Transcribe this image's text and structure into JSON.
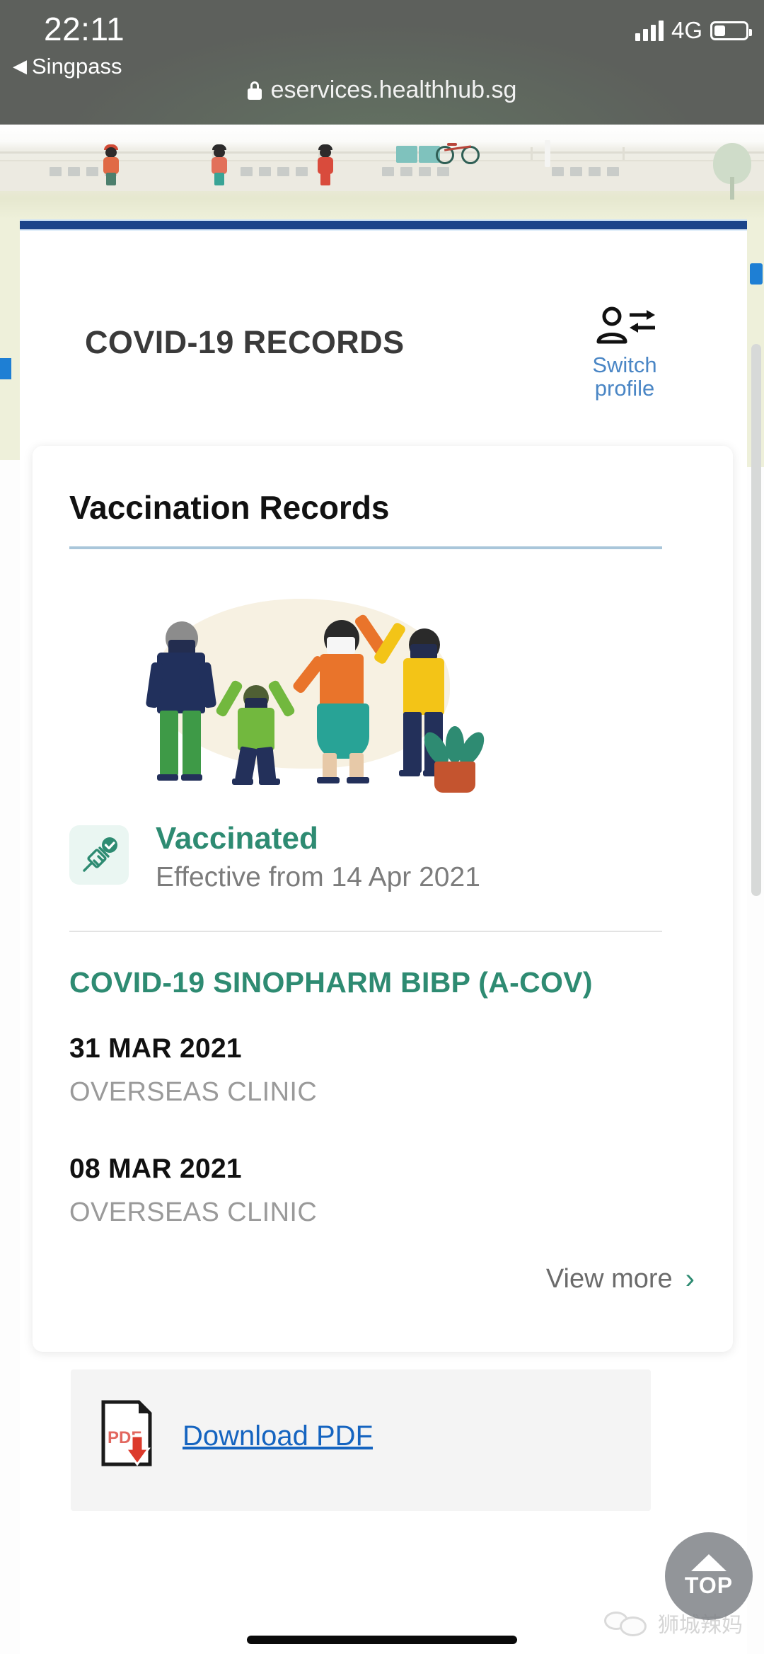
{
  "status_bar": {
    "time": "22:11",
    "back_label": "Singpass",
    "back_caret": "◀",
    "network": "4G",
    "signal_icon": "signal-bars-icon",
    "battery_icon": "battery-icon"
  },
  "browser": {
    "url": "eservices.healthhub.sg",
    "lock_icon": "lock-icon"
  },
  "header": {
    "page_title": "COVID-19 RECORDS",
    "switch_profile": {
      "label_line1": "Switch",
      "label_line2": "profile",
      "icon": "switch-profile-icon"
    }
  },
  "card": {
    "title": "Vaccination Records",
    "illustration_alt": "people-celebrating-illustration",
    "status": {
      "badge_icon": "syringe-check-icon",
      "title": "Vaccinated",
      "subtitle": "Effective from 14 Apr 2021"
    },
    "vaccine_name": "COVID-19 SINOPHARM BIBP (A-COV)",
    "doses": [
      {
        "date": "31 MAR 2021",
        "location": "OVERSEAS CLINIC"
      },
      {
        "date": "08 MAR 2021",
        "location": "OVERSEAS CLINIC"
      }
    ],
    "view_more": {
      "label": "View more",
      "chevron": "›"
    }
  },
  "download": {
    "label": "Download PDF",
    "icon": "pdf-download-icon"
  },
  "scroll_top_button": {
    "label": "TOP",
    "icon": "chevron-up-icon"
  },
  "watermark": {
    "text": "狮城辣妈",
    "icon": "wechat-bubbles-icon"
  },
  "colors": {
    "brand_blue": "#1b4489",
    "teal": "#2e8b72",
    "link_blue": "#1564c0",
    "switch_blue": "#4a86c5",
    "muted_gray": "#9a9a9a",
    "banner_green": "#eef0da",
    "chrome_gray": "#5d605c"
  }
}
